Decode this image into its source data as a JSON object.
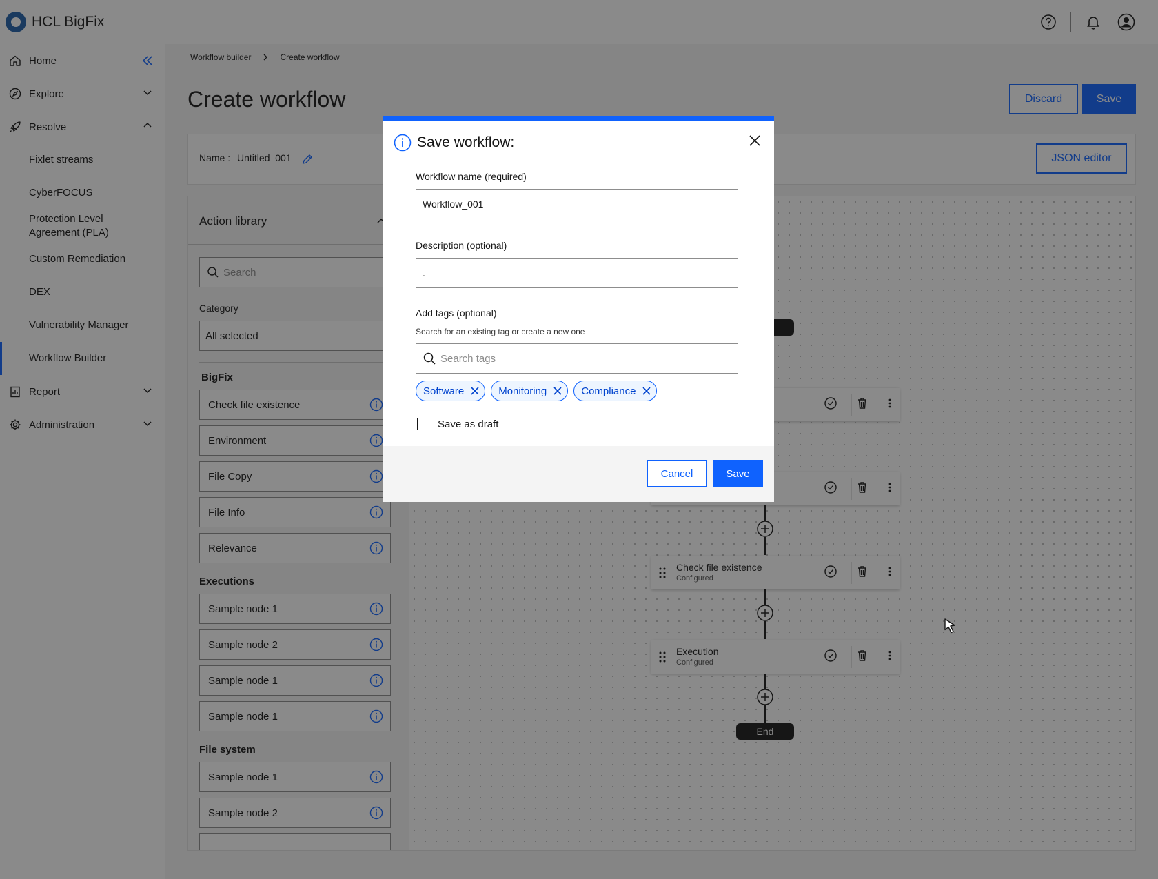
{
  "header": {
    "brand": "HCL BigFix",
    "icons": [
      "help-icon",
      "notification-icon",
      "user-icon"
    ]
  },
  "sidebar": {
    "items": [
      {
        "label": "Home",
        "icon": "home-icon"
      },
      {
        "label": "Explore",
        "icon": "compass-icon"
      },
      {
        "label": "Resolve",
        "icon": "rocket-icon"
      },
      {
        "label": "Report",
        "icon": "report-icon"
      },
      {
        "label": "Administration",
        "icon": "gear-icon"
      }
    ],
    "resolve_sub": [
      {
        "label": "Fixlet streams"
      },
      {
        "label": "CyberFOCUS"
      },
      {
        "label": "Protection Level Agreement (PLA)"
      },
      {
        "label": "Custom Remediation"
      },
      {
        "label": "DEX"
      },
      {
        "label": "Vulnerability Manager"
      },
      {
        "label": "Workflow Builder"
      }
    ],
    "active_item": "Workflow Builder"
  },
  "breadcrumb": {
    "link": "Workflow builder",
    "current": "Create workflow"
  },
  "page": {
    "title": "Create workflow",
    "discard_label": "Discard",
    "save_label": "Save",
    "name_label": "Name :",
    "name_value": "Untitled_001",
    "json_editor_label": "JSON editor"
  },
  "library": {
    "title": "Action library",
    "search_placeholder": "Search",
    "category_label": "Category",
    "category_value": "All selected",
    "groups": [
      {
        "name": "BigFix",
        "items": [
          "Check file existence",
          "Environment",
          "File Copy",
          "File Info",
          "Relevance"
        ]
      },
      {
        "name": "Executions",
        "items": [
          "Sample node 1",
          "Sample node 2",
          "Sample node 1",
          "Sample node 1"
        ]
      },
      {
        "name": "File system",
        "items": [
          "Sample node 1",
          "Sample node 2"
        ]
      }
    ]
  },
  "canvas": {
    "nodes": [
      {
        "title": "Check file existence",
        "status": "Configured"
      },
      {
        "title": "Execution",
        "status": "Configured"
      }
    ],
    "end_label": "End"
  },
  "modal": {
    "title": "Save workflow:",
    "name_label": "Workflow name (required)",
    "name_value": "Workflow_001",
    "description_label": "Description (optional)",
    "description_value": ".",
    "tags_label": "Add tags (optional)",
    "tags_help": "Search for an existing tag or create a new one",
    "tags_placeholder": "Search tags",
    "tags": [
      "Software",
      "Monitoring",
      "Compliance"
    ],
    "draft_label": "Save as draft",
    "draft_checked": false,
    "cancel_label": "Cancel",
    "save_label": "Save"
  },
  "colors": {
    "accent": "#0f62fe",
    "overlay": "#161616"
  }
}
